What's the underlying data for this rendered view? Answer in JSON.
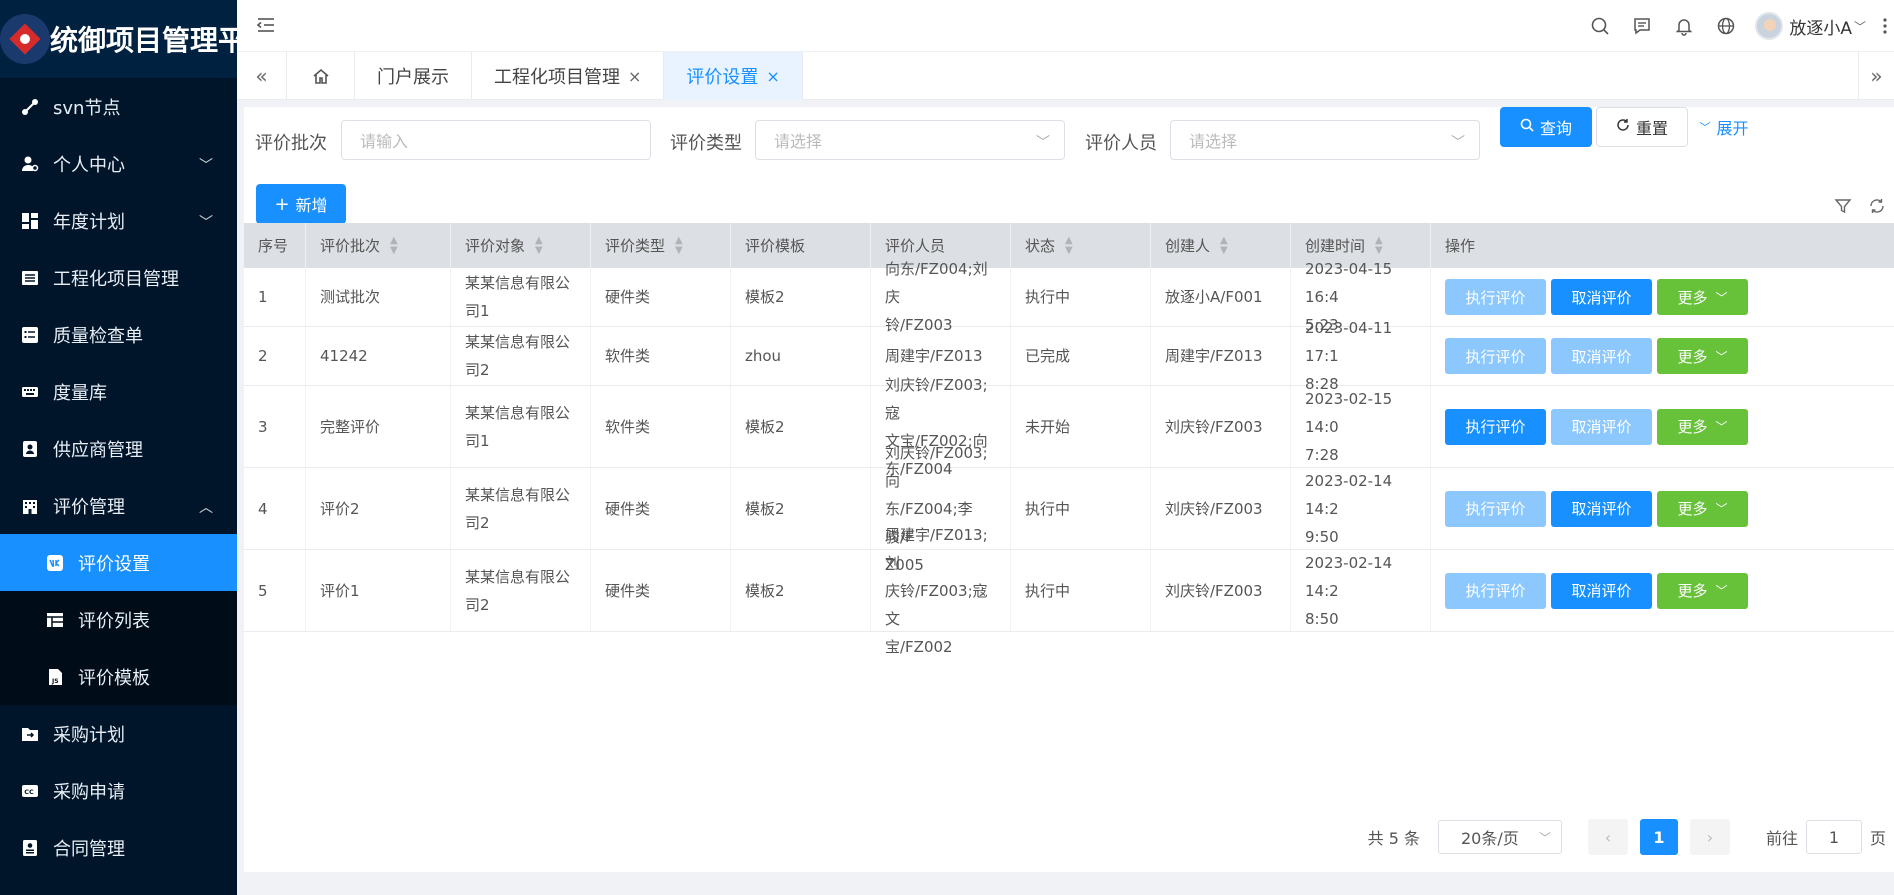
{
  "app": {
    "title": "统御项目管理平台"
  },
  "sidebar": {
    "items": [
      {
        "label": "svn节点",
        "icon": "svn-node-icon"
      },
      {
        "label": "个人中心",
        "icon": "user-gear-icon",
        "expandable": true
      },
      {
        "label": "年度计划",
        "icon": "dashboard-icon",
        "expandable": true
      },
      {
        "label": "工程化项目管理",
        "icon": "list-icon"
      },
      {
        "label": "质量检查单",
        "icon": "checklist-icon"
      },
      {
        "label": "度量库",
        "icon": "keyboard-icon"
      },
      {
        "label": "供应商管理",
        "icon": "contact-card-icon"
      },
      {
        "label": "评价管理",
        "icon": "building-icon",
        "expanded": true
      }
    ],
    "sub_items": [
      {
        "label": "评价设置",
        "icon": "vk-icon",
        "active": true
      },
      {
        "label": "评价列表",
        "icon": "table-icon"
      },
      {
        "label": "评价模板",
        "icon": "js-file-icon"
      }
    ],
    "items_after": [
      {
        "label": "采购计划",
        "icon": "folder-arrow-icon"
      },
      {
        "label": "采购申请",
        "icon": "cc-icon"
      },
      {
        "label": "合同管理",
        "icon": "id-card-icon"
      }
    ]
  },
  "header": {
    "user_name": "放逐小A"
  },
  "tabs": {
    "items": [
      {
        "label": "门户展示"
      },
      {
        "label": "工程化项目管理",
        "closable": true
      },
      {
        "label": "评价设置",
        "closable": true,
        "active": true
      }
    ]
  },
  "filters": {
    "batch_label": "评价批次",
    "batch_placeholder": "请输入",
    "type_label": "评价类型",
    "type_placeholder": "请选择",
    "person_label": "评价人员",
    "person_placeholder": "请选择",
    "query": "查询",
    "reset": "重置",
    "expand": "展开"
  },
  "toolbar": {
    "add": "新增"
  },
  "table": {
    "headers": [
      "序号",
      "评价批次",
      "评价对象",
      "评价类型",
      "评价模板",
      "评价人员",
      "状态",
      "创建人",
      "创建时间",
      "操作"
    ],
    "rows": [
      {
        "seq": "1",
        "batch": "测试批次",
        "obj": [
          "某某信息有限公",
          "司1"
        ],
        "type": "硬件类",
        "tpl": "模板2",
        "person": [
          "向东/FZ004;刘庆",
          "铃/FZ003"
        ],
        "status": "执行中",
        "creator": "放逐小A/F001",
        "time": [
          "2023-04-15 16:4",
          "5:23"
        ],
        "exec_disabled": true,
        "cancel_disabled": false,
        "height": 59
      },
      {
        "seq": "2",
        "batch": "41242",
        "obj": [
          "某某信息有限公",
          "司2"
        ],
        "type": "软件类",
        "tpl": "zhou",
        "person": [
          "周建宇/FZ013"
        ],
        "status": "已完成",
        "creator": "周建宇/FZ013",
        "time": [
          "2023-04-11 17:1",
          "8:28"
        ],
        "exec_disabled": true,
        "cancel_disabled": true,
        "height": 59
      },
      {
        "seq": "3",
        "batch": "完整评价",
        "obj": [
          "某某信息有限公",
          "司1"
        ],
        "type": "软件类",
        "tpl": "模板2",
        "person": [
          "刘庆铃/FZ003;寇",
          "文宝/FZ002;向",
          "东/FZ004"
        ],
        "status": "未开始",
        "creator": "刘庆铃/FZ003",
        "time": [
          "2023-02-15 14:0",
          "7:28"
        ],
        "exec_disabled": false,
        "cancel_disabled": true,
        "height": 82
      },
      {
        "seq": "4",
        "batch": "评价2",
        "obj": [
          "某某信息有限公",
          "司2"
        ],
        "type": "硬件类",
        "tpl": "模板2",
        "person": [
          "刘庆铃/FZ003;向",
          "东/FZ004;李骏/F",
          "Z005"
        ],
        "status": "执行中",
        "creator": "刘庆铃/FZ003",
        "time": [
          "2023-02-14 14:2",
          "9:50"
        ],
        "exec_disabled": true,
        "cancel_disabled": false,
        "height": 82
      },
      {
        "seq": "5",
        "batch": "评价1",
        "obj": [
          "某某信息有限公",
          "司2"
        ],
        "type": "硬件类",
        "tpl": "模板2",
        "person": [
          "周建宇/FZ013;刘",
          "庆铃/FZ003;寇文",
          "宝/FZ002"
        ],
        "status": "执行中",
        "creator": "刘庆铃/FZ003",
        "time": [
          "2023-02-14 14:2",
          "8:50"
        ],
        "exec_disabled": true,
        "cancel_disabled": false,
        "height": 82
      }
    ],
    "ops": {
      "exec": "执行评价",
      "cancel": "取消评价",
      "more": "更多"
    }
  },
  "pagination": {
    "total": "共 5 条",
    "page_size": "20条/页",
    "current": "1",
    "goto_prefix": "前往",
    "goto_value": "1",
    "goto_suffix": "页"
  },
  "colors": {
    "sidebar_bg": "#001529",
    "primary": "#1890ff",
    "primary_disabled": "#8cc8fd",
    "success": "#67c23a"
  }
}
